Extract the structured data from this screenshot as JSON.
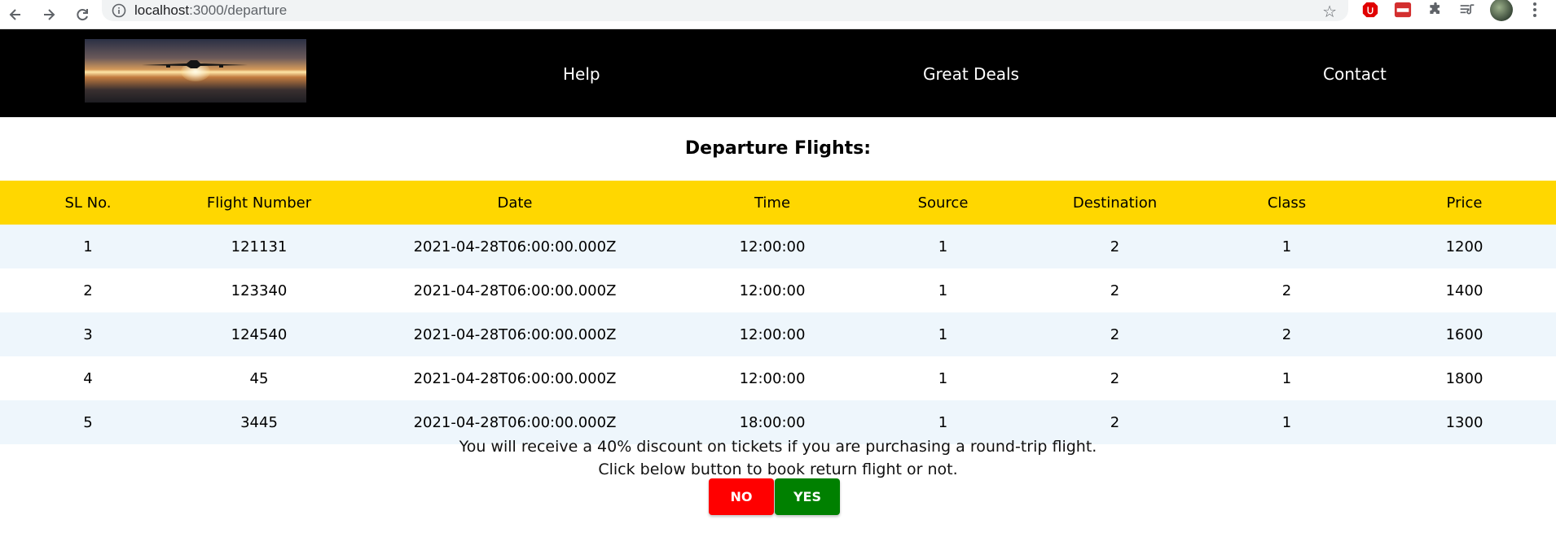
{
  "browser": {
    "url_host": "localhost",
    "url_path": ":3000/departure"
  },
  "header": {
    "nav": [
      "Help",
      "Great Deals",
      "Contact"
    ]
  },
  "main": {
    "title": "Departure Flights:",
    "table": {
      "columns": [
        "SL No.",
        "Flight Number",
        "Date",
        "Time",
        "Source",
        "Destination",
        "Class",
        "Price"
      ],
      "rows": [
        [
          "1",
          "121131",
          "2021-04-28T06:00:00.000Z",
          "12:00:00",
          "1",
          "2",
          "1",
          "1200"
        ],
        [
          "2",
          "123340",
          "2021-04-28T06:00:00.000Z",
          "12:00:00",
          "1",
          "2",
          "2",
          "1400"
        ],
        [
          "3",
          "124540",
          "2021-04-28T06:00:00.000Z",
          "12:00:00",
          "1",
          "2",
          "2",
          "1600"
        ],
        [
          "4",
          "45",
          "2021-04-28T06:00:00.000Z",
          "12:00:00",
          "1",
          "2",
          "1",
          "1800"
        ],
        [
          "5",
          "3445",
          "2021-04-28T06:00:00.000Z",
          "18:00:00",
          "1",
          "2",
          "1",
          "1300"
        ]
      ]
    },
    "notice_line1": "You will receive a 40% discount on tickets if you are purchasing a round-trip flight.",
    "notice_line2": "Click below button to book return flight or not.",
    "buttons": {
      "no": "NO",
      "yes": "YES"
    }
  },
  "colors": {
    "header_bg": "#000000",
    "table_header_bg": "#ffd700",
    "row_stripe": "#eef6fc",
    "no_button": "#ff0000",
    "yes_button": "#008000"
  }
}
